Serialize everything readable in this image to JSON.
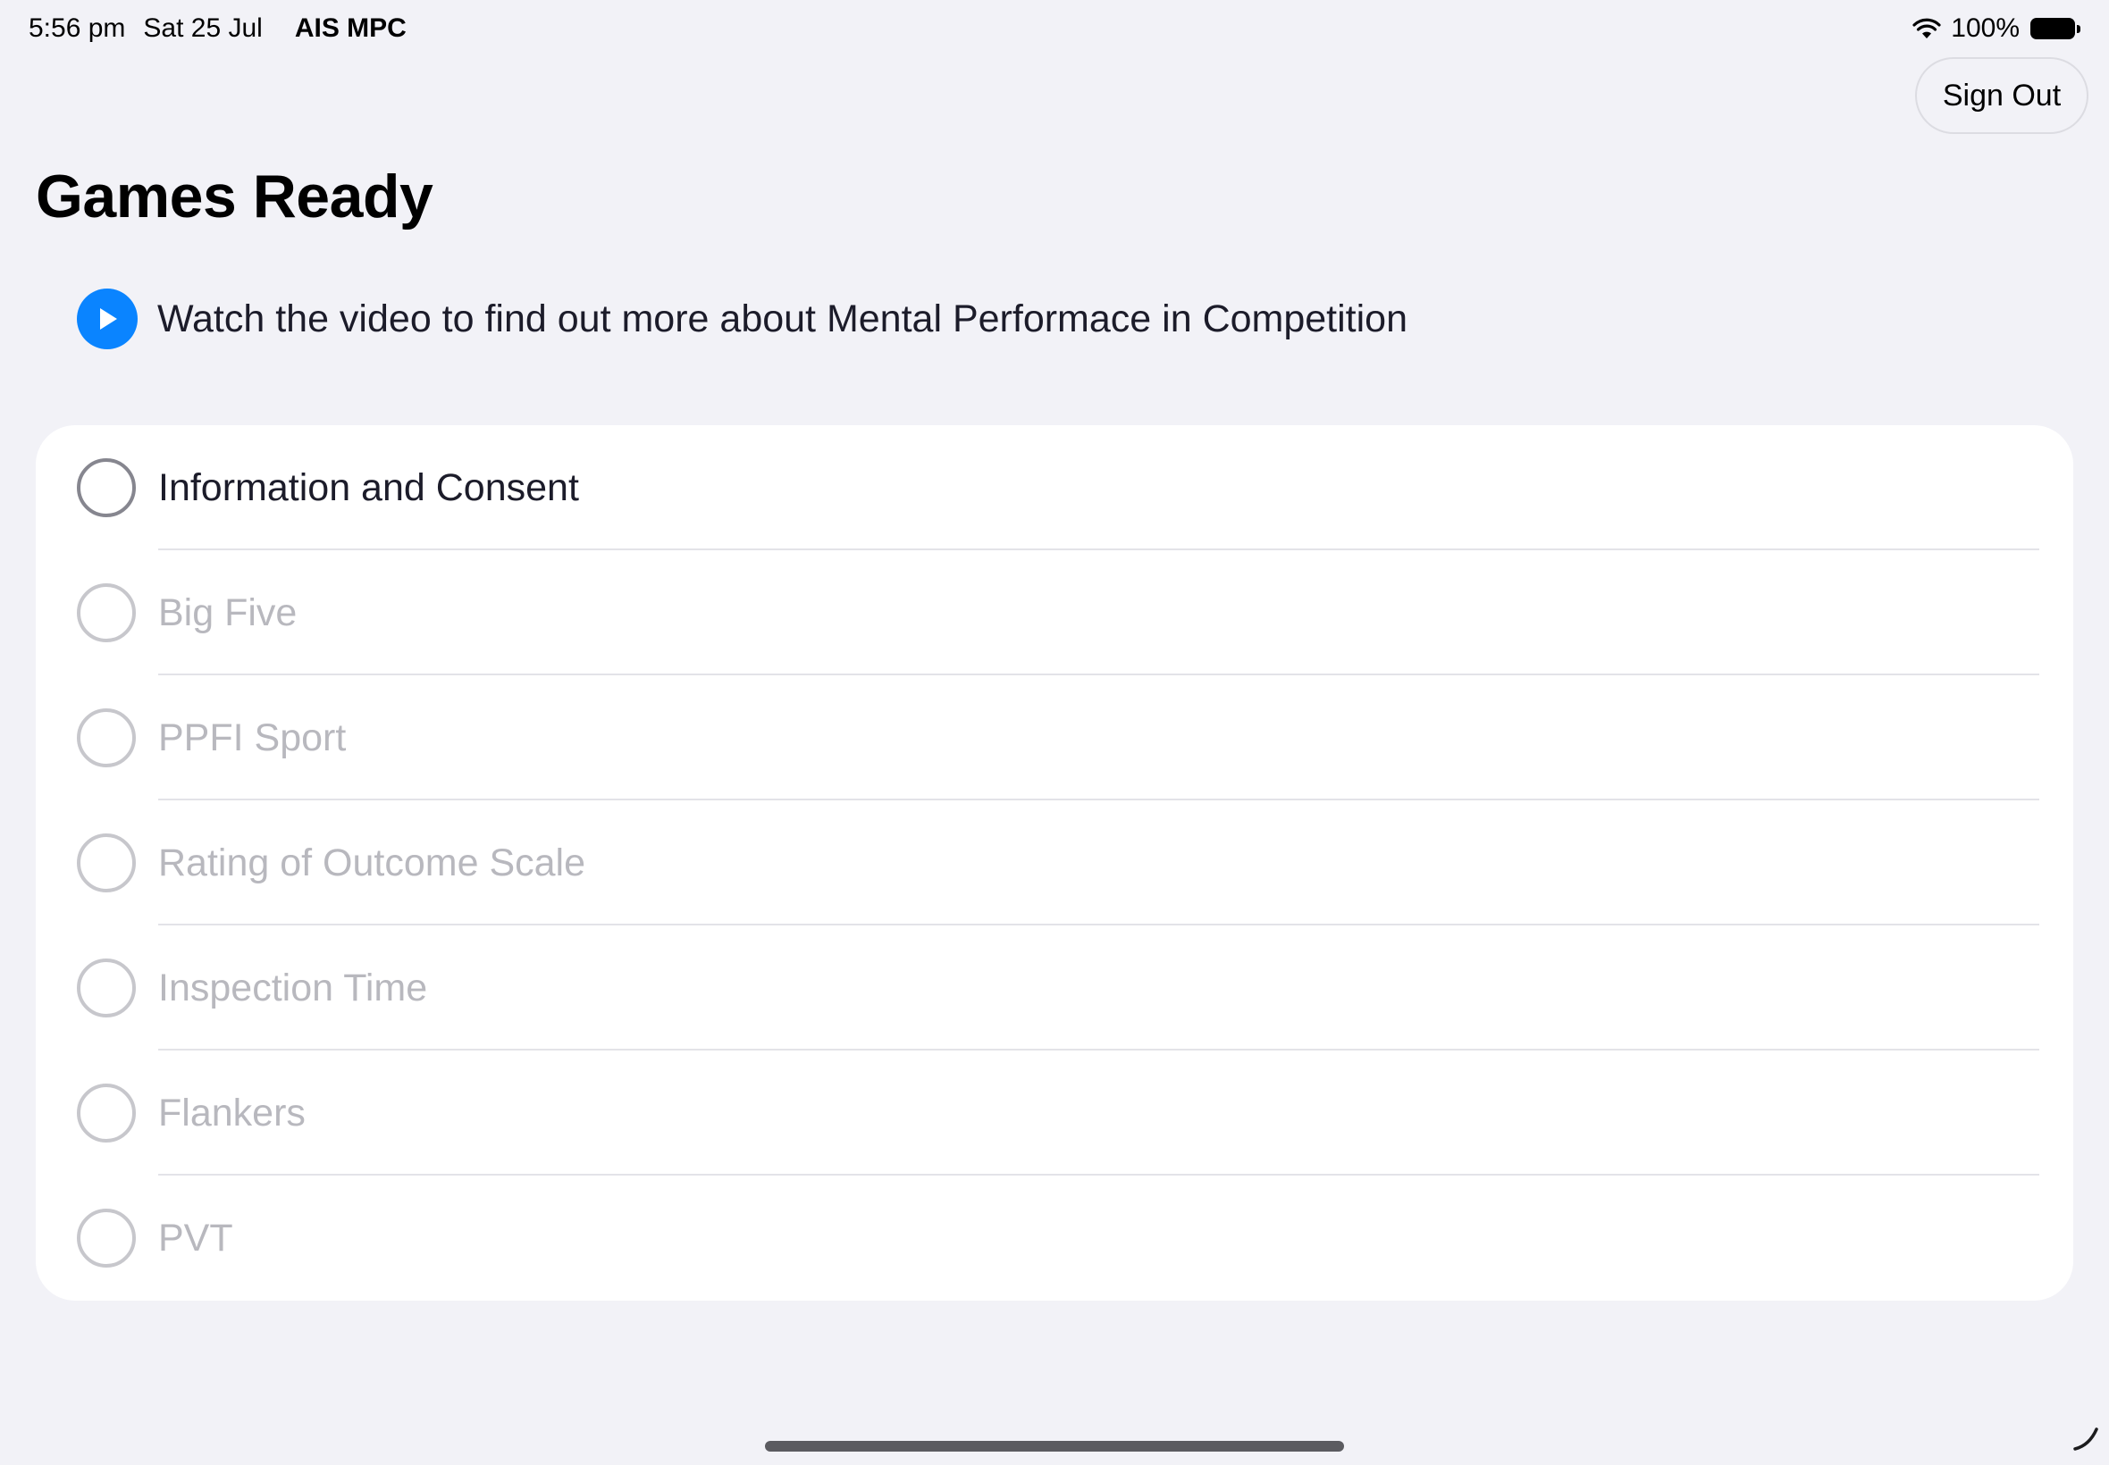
{
  "status_bar": {
    "time": "5:56 pm",
    "date": "Sat 25 Jul",
    "carrier": "AIS MPC",
    "battery": "100%",
    "icons": [
      "wifi-icon",
      "battery-icon"
    ]
  },
  "header": {
    "sign_out_label": "Sign Out"
  },
  "page": {
    "title": "Games Ready",
    "video_prompt": "Watch the video to find out more about Mental Performace in Competition"
  },
  "tasks": [
    {
      "label": "Information and Consent",
      "enabled": true
    },
    {
      "label": "Big Five",
      "enabled": false
    },
    {
      "label": "PPFI Sport",
      "enabled": false
    },
    {
      "label": "Rating of Outcome Scale",
      "enabled": false
    },
    {
      "label": "Inspection Time",
      "enabled": false
    },
    {
      "label": "Flankers",
      "enabled": false
    },
    {
      "label": "PVT",
      "enabled": false
    }
  ],
  "colors": {
    "accent": "#0a84ff",
    "background": "#f2f2f7",
    "active_text": "#1c1c2a",
    "disabled_text": "#b8b8be"
  }
}
